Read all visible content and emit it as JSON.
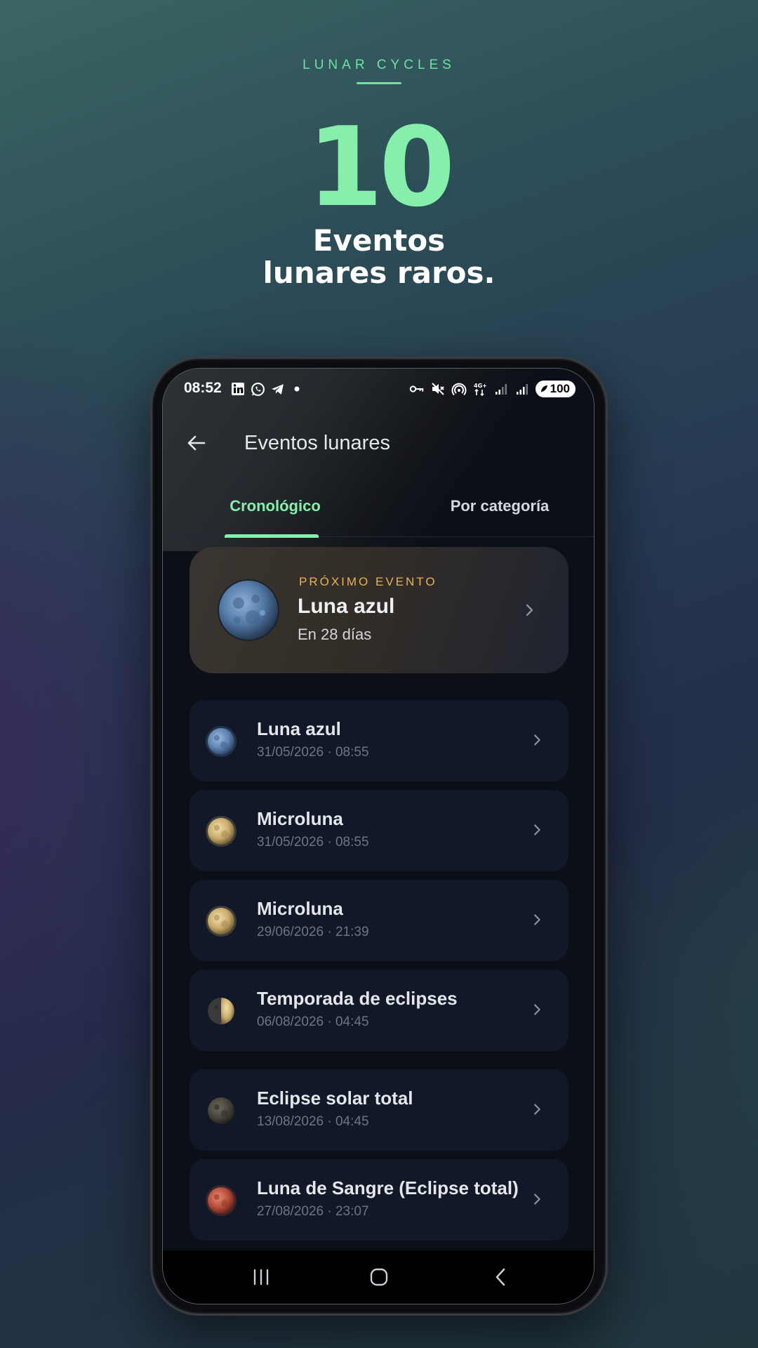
{
  "promo": {
    "kicker": "LUNAR CYCLES",
    "number": "10",
    "title_line1": "Eventos",
    "title_line2": "lunares raros."
  },
  "status_bar": {
    "time": "08:52",
    "battery": "100",
    "left_icons": [
      "linkedin-icon",
      "whatsapp-icon",
      "telegram-icon",
      "dot-icon"
    ],
    "right_icons": [
      "vpn-key-icon",
      "mute-icon",
      "hotspot-icon",
      "4g-icon",
      "signal-icon",
      "signal-icon",
      "battery-icon"
    ]
  },
  "app_bar": {
    "title": "Eventos lunares"
  },
  "tabs": [
    {
      "label": "Cronológico",
      "active": true
    },
    {
      "label": "Por categoría",
      "active": false
    }
  ],
  "next_event": {
    "kicker": "PRÓXIMO EVENTO",
    "title": "Luna azul",
    "subtitle": "En 28 días",
    "moon": "blue-moon"
  },
  "events": [
    {
      "name": "Luna azul",
      "date": "31/05/2026 · 08:55",
      "moon": "blue-moon"
    },
    {
      "name": "Microluna",
      "date": "31/05/2026 · 08:55",
      "moon": "golden-moon"
    },
    {
      "name": "Microluna",
      "date": "29/06/2026 · 21:39",
      "moon": "golden-moon"
    },
    {
      "name": "Temporada de eclipses",
      "date": "06/08/2026 · 04:45",
      "moon": "half-moon"
    },
    {
      "name": "Eclipse solar total",
      "date": "13/08/2026 · 04:45",
      "moon": "dark-moon"
    },
    {
      "name": "Luna de Sangre (Eclipse total)",
      "date": "27/08/2026 · 23:07",
      "moon": "blood-moon"
    }
  ],
  "colors": {
    "accent": "#86efac",
    "kicker_gold": "#e6b25c",
    "card_bg": "#111827",
    "screen_bg": "#0b0f17"
  },
  "nav_bar": [
    "recents-icon",
    "home-icon",
    "back-icon"
  ]
}
